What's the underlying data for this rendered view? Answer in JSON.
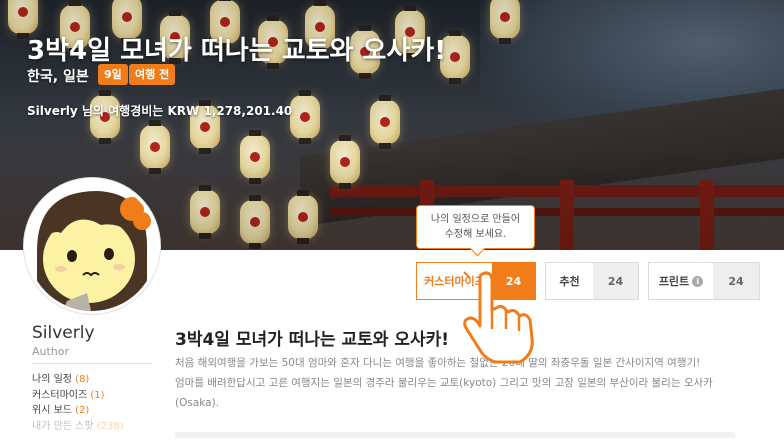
{
  "hero": {
    "title": "3박4일 모녀가 떠나는 교토와 오사카!",
    "location": "한국, 일본",
    "badges": [
      "9일",
      "여행 전"
    ],
    "budget_line": "Silverly 님의 여행경비는 KRW 1,278,201.40"
  },
  "tooltip": {
    "line1": "나의 일정으로 만들어",
    "line2": "수정해 보세요."
  },
  "actions": {
    "customize": {
      "label": "커스터마이즈",
      "count": "24"
    },
    "recommend": {
      "label": "추천",
      "count": "24"
    },
    "print": {
      "label": "프린트",
      "count": "24",
      "icon": "info-icon"
    }
  },
  "author": {
    "name": "Silverly",
    "role": "Author"
  },
  "sidebar": {
    "items": [
      {
        "label": "나의 일정",
        "count": "(8)"
      },
      {
        "label": "커스터마이즈",
        "count": "(1)"
      },
      {
        "label": "위시 보드",
        "count": "(2)"
      },
      {
        "label": "내가 만든 스팟",
        "count": "(238)"
      }
    ]
  },
  "main": {
    "title": "3박4일 모녀가 떠나는 교토와 오사카!",
    "desc": [
      "처음 해외여행을 가보는 50대 엄마와 혼자 다니는 여행을 좋아하는 철없는 20대 딸의 좌충우돌 일본 간사이지역 여행기!",
      "엄마를 배려한답시고 고른 여행지는 일본의 경주라 불리우는 교토(kyoto) 그리고 맛의 고장 일본의 부산이라 불리는 오사카",
      "(Osaka)."
    ]
  },
  "colors": {
    "accent": "#f07c1a",
    "muted_button": "#eeeeee"
  }
}
